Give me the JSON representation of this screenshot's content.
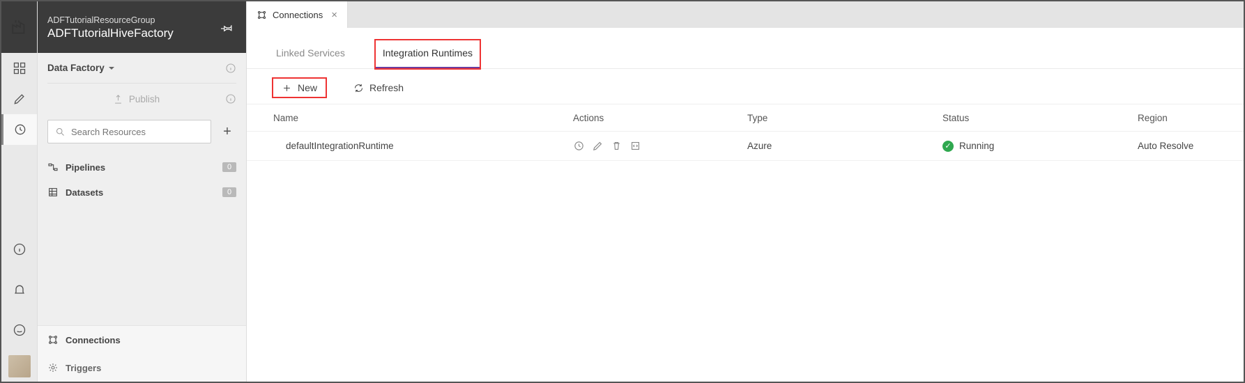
{
  "header": {
    "resource_group": "ADFTutorialResourceGroup",
    "factory_name": "ADFTutorialHiveFactory"
  },
  "sidebar": {
    "context_label": "Data Factory",
    "publish_label": "Publish",
    "search_placeholder": "Search Resources",
    "tree": {
      "pipelines": {
        "label": "Pipelines",
        "count": "0"
      },
      "datasets": {
        "label": "Datasets",
        "count": "0"
      }
    },
    "bottom": {
      "connections": "Connections",
      "triggers": "Triggers"
    }
  },
  "window_tabs": [
    {
      "label": "Connections"
    }
  ],
  "subtabs": {
    "linked_services": "Linked Services",
    "integration_runtimes": "Integration Runtimes"
  },
  "toolbar": {
    "new": "New",
    "refresh": "Refresh"
  },
  "table": {
    "headers": {
      "name": "Name",
      "actions": "Actions",
      "type": "Type",
      "status": "Status",
      "region": "Region"
    },
    "rows": [
      {
        "name": "defaultIntegrationRuntime",
        "type": "Azure",
        "status": "Running",
        "region": "Auto Resolve"
      }
    ]
  }
}
